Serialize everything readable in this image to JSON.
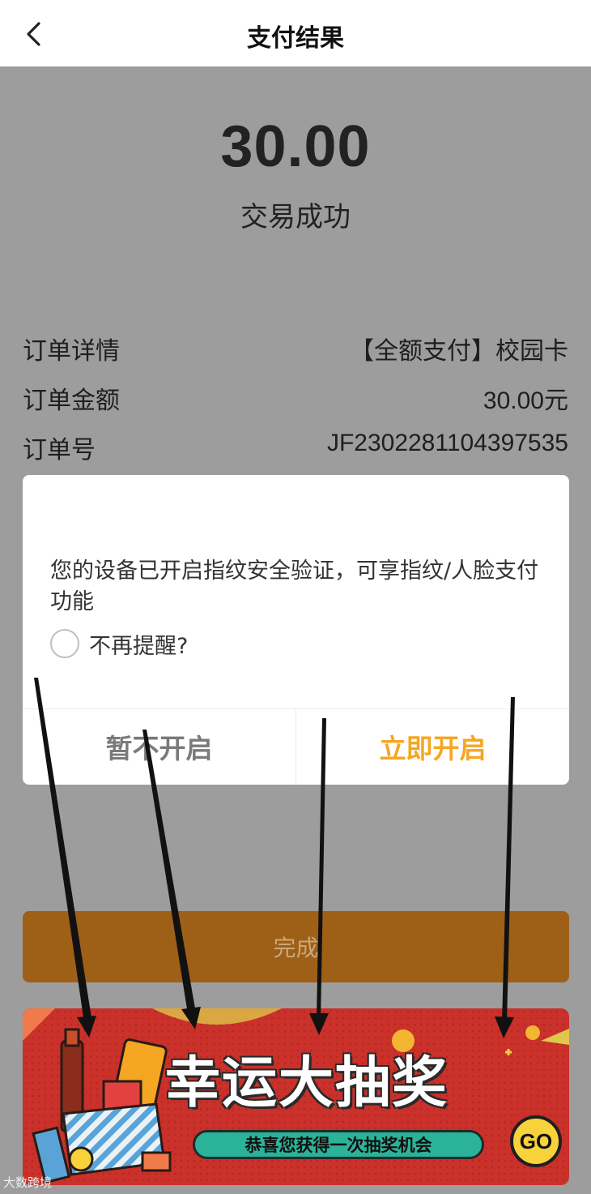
{
  "header": {
    "title": "支付结果",
    "back_icon": "chevron-left-icon"
  },
  "result": {
    "amount": "30.00",
    "status": "交易成功"
  },
  "order": {
    "detail_label": "订单详情",
    "detail_value": "【全额支付】校园卡",
    "amount_label": "订单金额",
    "amount_value": "30.00元",
    "number_label": "订单号",
    "number_value": "JF2302281104397535"
  },
  "dialog": {
    "message": "您的设备已开启指纹安全验证，可享指纹/人脸支付功能",
    "remind_label": "不再提醒?",
    "remind_checked": false,
    "later_label": "暂不开启",
    "enable_label": "立即开启"
  },
  "done_label": "完成",
  "banner": {
    "headline": "幸运大抽奖",
    "subline": "恭喜您获得一次抽奖机会",
    "go_label": "GO"
  },
  "watermark": "大数跨境",
  "colors": {
    "overlay_bg": "#9d9d9d",
    "accent": "#f5a623",
    "done_button": "#9e5f17",
    "banner_red": "#c9312a",
    "ribbon_teal": "#2bb39a"
  }
}
